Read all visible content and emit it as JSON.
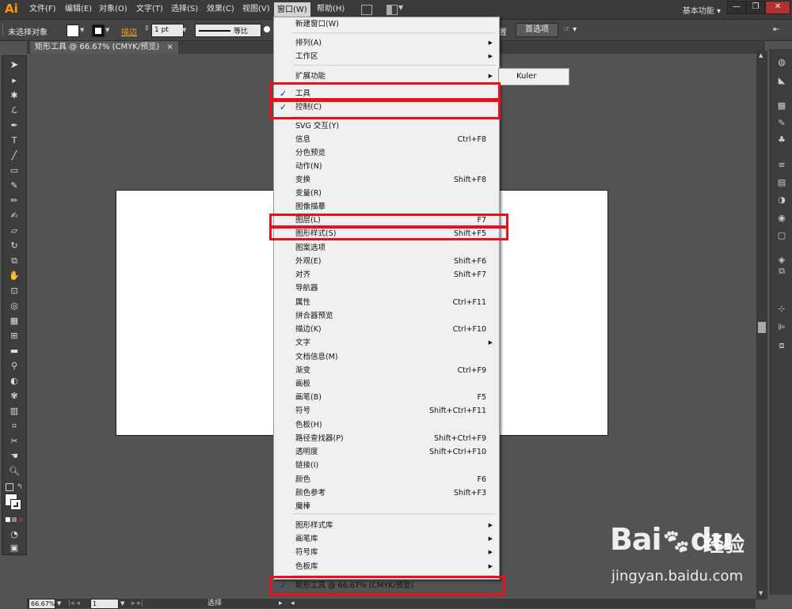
{
  "app": {
    "logo": "Ai",
    "menus": [
      "文件(F)",
      "编辑(E)",
      "对象(O)",
      "文字(T)",
      "选择(S)",
      "效果(C)",
      "视图(V)",
      "窗口(W)",
      "帮助(H)"
    ],
    "workspace": "基本功能",
    "win_buttons": [
      "—",
      "❐",
      "✕"
    ]
  },
  "control": {
    "no_selection": "未选择对象",
    "stroke_label": "描边",
    "stroke_weight": "1 pt",
    "stroke_style": "等比",
    "doc_setup_frag": "置",
    "prefs_button": "首选项"
  },
  "doc_tab": {
    "title": "矩形工具 @ 66.67% (CMYK/预览)",
    "close": "×"
  },
  "status": {
    "zoom": "66.67%",
    "page": "1",
    "tool": "选择"
  },
  "window_menu": {
    "items": [
      {
        "label": "新建窗口(W)"
      },
      {
        "label": "排列(A)",
        "submenu": true
      },
      {
        "label": "工作区",
        "submenu": true
      },
      {
        "label": "扩展功能",
        "submenu": true
      },
      {
        "label": "工具",
        "checked": true
      },
      {
        "label": "控制(C)",
        "checked": true
      },
      {
        "label": "SVG 交互(Y)"
      },
      {
        "label": "信息",
        "shortcut": "Ctrl+F8"
      },
      {
        "label": "分色预览"
      },
      {
        "label": "动作(N)"
      },
      {
        "label": "变换",
        "shortcut": "Shift+F8"
      },
      {
        "label": "变量(R)"
      },
      {
        "label": "图像描摹"
      },
      {
        "label": "图层(L)",
        "shortcut": "F7"
      },
      {
        "label": "图形样式(S)",
        "shortcut": "Shift+F5"
      },
      {
        "label": "图案选项"
      },
      {
        "label": "外观(E)",
        "shortcut": "Shift+F6"
      },
      {
        "label": "对齐",
        "shortcut": "Shift+F7"
      },
      {
        "label": "导航器"
      },
      {
        "label": "属性",
        "shortcut": "Ctrl+F11"
      },
      {
        "label": "拼合器预览"
      },
      {
        "label": "描边(K)",
        "shortcut": "Ctrl+F10"
      },
      {
        "label": "文字",
        "submenu": true
      },
      {
        "label": "文档信息(M)"
      },
      {
        "label": "渐变",
        "shortcut": "Ctrl+F9"
      },
      {
        "label": "画板"
      },
      {
        "label": "画笔(B)",
        "shortcut": "F5"
      },
      {
        "label": "符号",
        "shortcut": "Shift+Ctrl+F11"
      },
      {
        "label": "色板(H)"
      },
      {
        "label": "路径查找器(P)",
        "shortcut": "Shift+Ctrl+F9"
      },
      {
        "label": "透明度",
        "shortcut": "Shift+Ctrl+F10"
      },
      {
        "label": "链接(I)"
      },
      {
        "label": "颜色",
        "shortcut": "F6"
      },
      {
        "label": "颜色参考",
        "shortcut": "Shift+F3"
      },
      {
        "label": "魔棒"
      },
      {
        "label": "图形样式库",
        "submenu": true
      },
      {
        "label": "画笔库",
        "submenu": true
      },
      {
        "label": "符号库",
        "submenu": true
      },
      {
        "label": "色板库",
        "submenu": true
      },
      {
        "label": "矩形工具 @ 66.67% (CMYK/预览)",
        "checked": true
      }
    ]
  },
  "submenu_extension": {
    "item": "Kuler"
  },
  "watermark": {
    "brand_left": "Bai",
    "brand_right": "du",
    "brand_cn": "经验",
    "url": "jingyan.baidu.com"
  },
  "colors": {
    "highlight": "#e8101a",
    "accent": "#ff9a00"
  }
}
